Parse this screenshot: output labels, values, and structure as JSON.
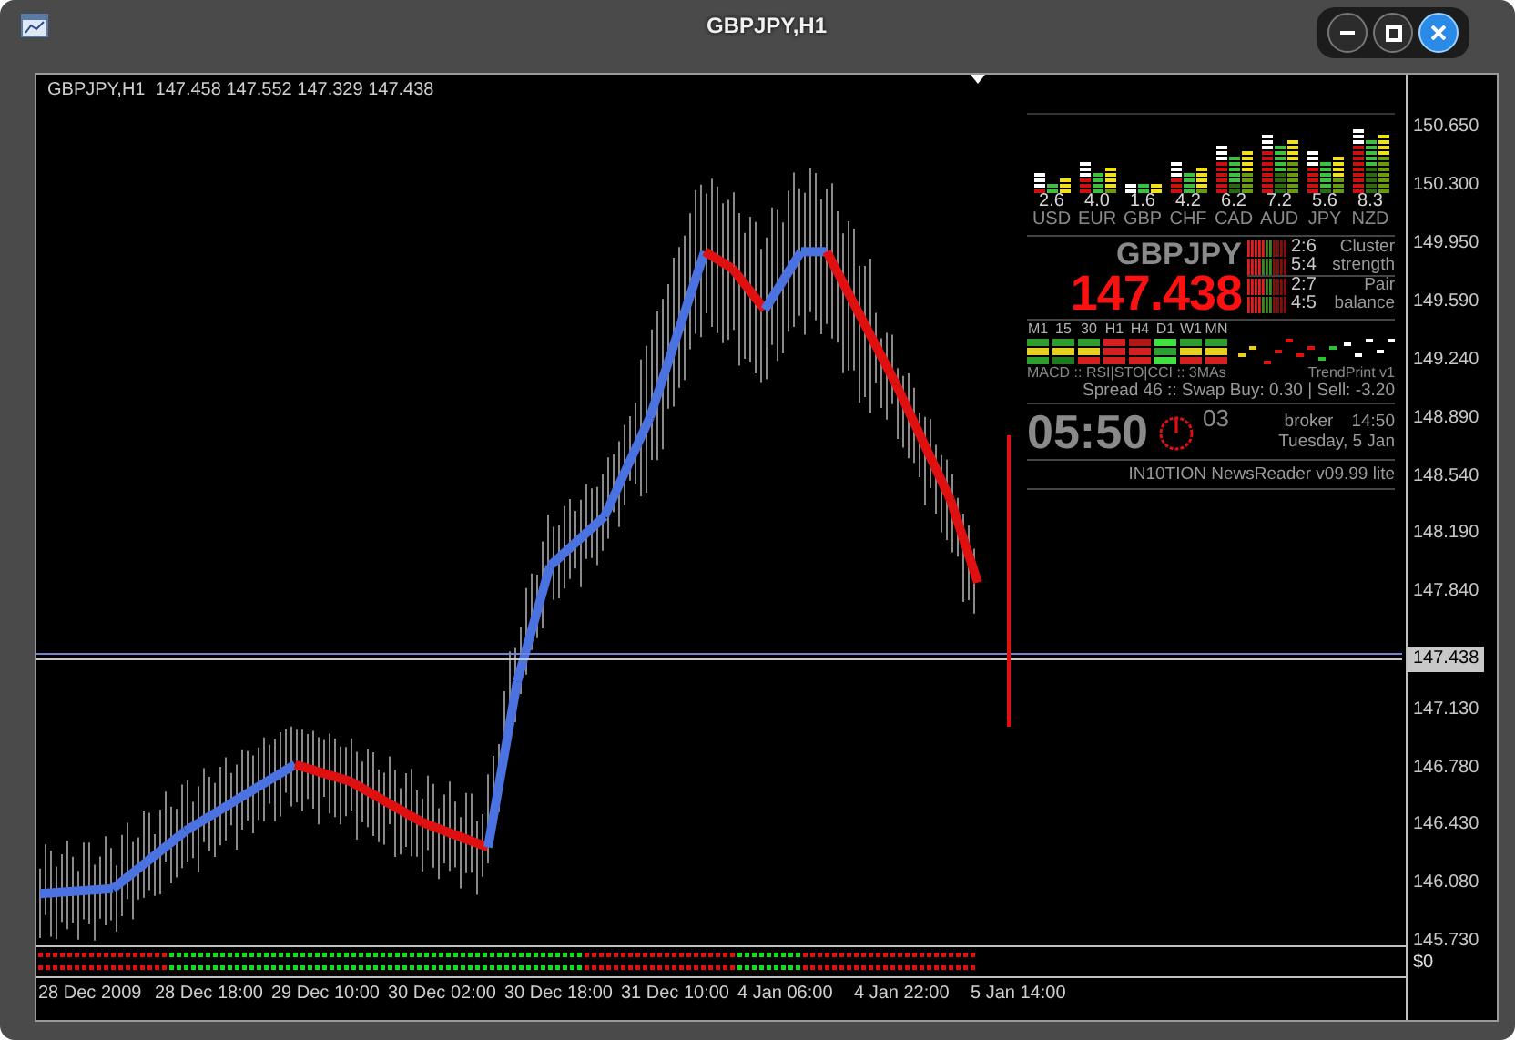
{
  "window": {
    "title": "GBPJPY,H1"
  },
  "chart": {
    "header": "GBPJPY,H1  147.458 147.552 147.329 147.438",
    "price_ticks": [
      "150.650",
      "150.300",
      "149.950",
      "149.590",
      "149.240",
      "148.890",
      "148.540",
      "148.190",
      "147.840",
      "147.130",
      "146.780",
      "146.430",
      "146.080",
      "145.730"
    ],
    "current_price": "147.438",
    "indicator_scale": "$0",
    "date_labels": [
      "28 Dec 2009",
      "28 Dec 18:00",
      "29 Dec 10:00",
      "30 Dec 02:00",
      "30 Dec 18:00",
      "31 Dec 10:00",
      "4 Jan 06:00",
      "4 Jan 22:00",
      "5 Jan 14:00"
    ]
  },
  "panel": {
    "currencies": [
      {
        "value": "2.6",
        "code": "USD"
      },
      {
        "value": "4.0",
        "code": "EUR"
      },
      {
        "value": "1.6",
        "code": "GBP"
      },
      {
        "value": "4.2",
        "code": "CHF"
      },
      {
        "value": "6.2",
        "code": "CAD"
      },
      {
        "value": "7.2",
        "code": "AUD"
      },
      {
        "value": "5.6",
        "code": "JPY"
      },
      {
        "value": "8.3",
        "code": "NZD"
      }
    ],
    "symbol": "GBPJPY",
    "price": "147.438",
    "balances": [
      {
        "ratios": [
          "2:6",
          "5:4"
        ],
        "label": "Cluster strength"
      },
      {
        "ratios": [
          "2:7",
          "4:5"
        ],
        "label": "Pair balance"
      }
    ],
    "timeframes": [
      {
        "label": "M1",
        "cells": [
          {
            "color": "#2e9e2e"
          },
          {
            "color": "#e8d020"
          },
          {
            "color": "#2e9e2e"
          }
        ]
      },
      {
        "label": "15",
        "cells": [
          {
            "color": "#2e9e2e"
          },
          {
            "color": "#e8d020"
          },
          {
            "color": "#1f7a1f"
          }
        ]
      },
      {
        "label": "30",
        "cells": [
          {
            "color": "#2e9e2e"
          },
          {
            "color": "#e8d020"
          },
          {
            "color": "#d42020"
          }
        ]
      },
      {
        "label": "H1",
        "cells": [
          {
            "color": "#d42020"
          },
          {
            "color": "#d42020"
          },
          {
            "color": "#d42020"
          }
        ]
      },
      {
        "label": "H4",
        "cells": [
          {
            "color": "#b01818"
          },
          {
            "color": "#d42020"
          },
          {
            "color": "#d42020"
          }
        ]
      },
      {
        "label": "D1",
        "cells": [
          {
            "color": "#40e040"
          },
          {
            "color": "#2e9e2e"
          },
          {
            "color": "#40e040"
          }
        ]
      },
      {
        "label": "W1",
        "cells": [
          {
            "color": "#2e9e2e"
          },
          {
            "color": "#e8d020"
          },
          {
            "color": "#d42020"
          }
        ]
      },
      {
        "label": "MN",
        "cells": [
          {
            "color": "#2e9e2e"
          },
          {
            "color": "#e8d020"
          },
          {
            "color": "#d42020"
          }
        ]
      }
    ],
    "indicators_label": "MACD :: RSI|STO|CCI :: 3MAs",
    "trendprint_label": "TrendPrint v1",
    "spread": "Spread 46 :: Swap Buy: 0.30 | Sell: -3.20",
    "countdown": "05:50",
    "minutes": "03",
    "broker_label": "broker",
    "broker_time": "14:50",
    "date": "Tuesday, 5 Jan",
    "footer": "IN10TION NewsReader v09.99 lite"
  }
}
